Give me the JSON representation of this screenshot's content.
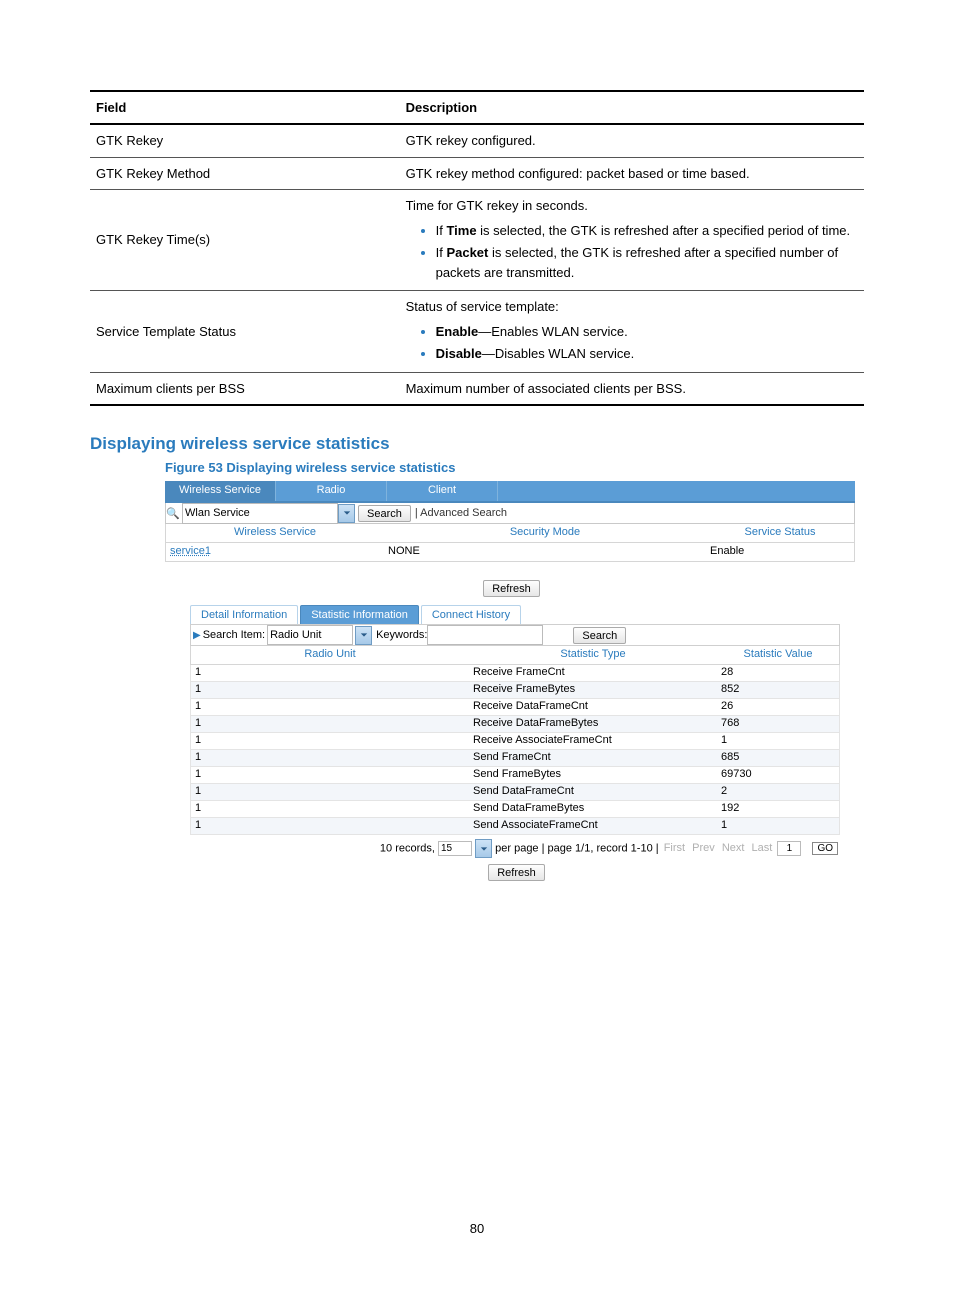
{
  "table": {
    "head": {
      "field": "Field",
      "desc": "Description"
    },
    "rows": [
      {
        "field": "GTK Rekey",
        "desc": "GTK rekey configured."
      },
      {
        "field": "GTK Rekey Method",
        "desc": "GTK rekey method configured: packet based or time based."
      },
      {
        "field": "GTK Rekey Time(s)",
        "intro": "Time for GTK rekey in seconds.",
        "b1p": "If ",
        "b1b": "Time",
        "b1s": " is selected, the GTK is refreshed after a specified period of time.",
        "b2p": "If ",
        "b2b": "Packet",
        "b2s": " is selected, the GTK is refreshed after a specified number of packets are transmitted."
      },
      {
        "field": "Service Template Status",
        "intro": "Status of service template:",
        "b1b": "Enable",
        "b1s": "—Enables WLAN service.",
        "b2b": "Disable",
        "b2s": "—Disables WLAN service."
      },
      {
        "field": "Maximum clients per BSS",
        "desc": "Maximum number of associated clients per BSS."
      }
    ]
  },
  "section_heading": "Displaying wireless service statistics",
  "figure_caption": "Figure 53 Displaying wireless service statistics",
  "top_tabs": [
    "Wireless Service",
    "Radio",
    "Client"
  ],
  "search": {
    "select_value": "Wlan Service",
    "button": "Search",
    "adv": "Advanced Search"
  },
  "results": {
    "head": {
      "ws": "Wireless Service",
      "sm": "Security Mode",
      "ss": "Service Status"
    },
    "row": {
      "ws": "service1",
      "sm": "NONE",
      "ss": "Enable"
    }
  },
  "refresh_label": "Refresh",
  "inner_tabs": [
    "Detail Information",
    "Statistic Information",
    "Connect History"
  ],
  "inner_search": {
    "label": "Search Item:",
    "item_value": "Radio Unit",
    "kw_label": "Keywords:",
    "button": "Search"
  },
  "stats": {
    "head": {
      "ru": "Radio Unit",
      "st": "Statistic Type",
      "sv": "Statistic Value"
    },
    "rows": [
      {
        "ru": "1",
        "st": "Receive FrameCnt",
        "sv": "28"
      },
      {
        "ru": "1",
        "st": "Receive FrameBytes",
        "sv": "852"
      },
      {
        "ru": "1",
        "st": "Receive DataFrameCnt",
        "sv": "26"
      },
      {
        "ru": "1",
        "st": "Receive DataFrameBytes",
        "sv": "768"
      },
      {
        "ru": "1",
        "st": "Receive AssociateFrameCnt",
        "sv": "1"
      },
      {
        "ru": "1",
        "st": "Send FrameCnt",
        "sv": "685"
      },
      {
        "ru": "1",
        "st": "Send FrameBytes",
        "sv": "69730"
      },
      {
        "ru": "1",
        "st": "Send DataFrameCnt",
        "sv": "2"
      },
      {
        "ru": "1",
        "st": "Send DataFrameBytes",
        "sv": "192"
      },
      {
        "ru": "1",
        "st": "Send AssociateFrameCnt",
        "sv": "1"
      }
    ]
  },
  "paging": {
    "records": "10 records,",
    "per_page_value": "15",
    "per_page_label": "per page | page 1/1, record 1-10 |",
    "first": "First",
    "prev": "Prev",
    "next": "Next",
    "last": "Last",
    "page_input": "1",
    "go": "GO"
  },
  "page_number": "80",
  "chart_data": {
    "type": "table",
    "title": "Statistic Information — service1, Radio Unit 1",
    "columns": [
      "Statistic Type",
      "Statistic Value"
    ],
    "rows": [
      [
        "Receive FrameCnt",
        28
      ],
      [
        "Receive FrameBytes",
        852
      ],
      [
        "Receive DataFrameCnt",
        26
      ],
      [
        "Receive DataFrameBytes",
        768
      ],
      [
        "Receive AssociateFrameCnt",
        1
      ],
      [
        "Send FrameCnt",
        685
      ],
      [
        "Send FrameBytes",
        69730
      ],
      [
        "Send DataFrameCnt",
        2
      ],
      [
        "Send DataFrameBytes",
        192
      ],
      [
        "Send AssociateFrameCnt",
        1
      ]
    ]
  }
}
